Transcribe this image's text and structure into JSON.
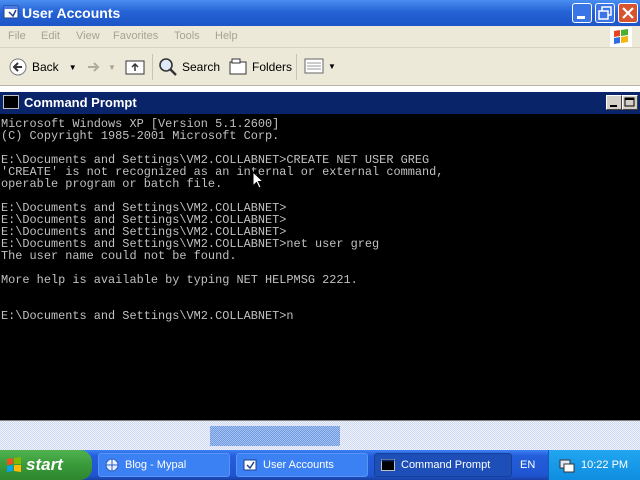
{
  "explorer": {
    "title": "User Accounts",
    "menu": [
      "File",
      "Edit",
      "View",
      "Favorites",
      "Tools",
      "Help"
    ],
    "toolbar": {
      "back": "Back",
      "search": "Search",
      "folders": "Folders"
    },
    "icons": [
      "window-icon",
      "back-arrow-icon",
      "forward-arrow-icon",
      "up-folder-icon",
      "search-icon",
      "folders-icon",
      "views-icon",
      "windows-flag-icon"
    ]
  },
  "cmd": {
    "title": "Command Prompt",
    "lines": [
      "Microsoft Windows XP [Version 5.1.2600]",
      "(C) Copyright 1985-2001 Microsoft Corp.",
      "",
      "E:\\Documents and Settings\\VM2.COLLABNET>CREATE NET USER GREG",
      "'CREATE' is not recognized as an internal or external command,",
      "operable program or batch file.",
      "",
      "E:\\Documents and Settings\\VM2.COLLABNET>",
      "E:\\Documents and Settings\\VM2.COLLABNET>",
      "E:\\Documents and Settings\\VM2.COLLABNET>",
      "E:\\Documents and Settings\\VM2.COLLABNET>net user greg",
      "The user name could not be found.",
      "",
      "More help is available by typing NET HELPMSG 2221.",
      "",
      "",
      "E:\\Documents and Settings\\VM2.COLLABNET>n"
    ]
  },
  "taskbar": {
    "start": "start",
    "tasks": [
      {
        "label": "Blog - Mypal",
        "icon": "browser-icon"
      },
      {
        "label": "User Accounts",
        "icon": "user-accounts-icon"
      },
      {
        "label": "Command Prompt",
        "icon": "cmd-icon"
      }
    ],
    "lang": "EN",
    "clock": "10:22 PM"
  },
  "colors": {
    "xp_title_blue": "#245edb",
    "cmd_title_navy": "#0a246a",
    "console_bg": "#000000",
    "console_text": "#c0c0c0",
    "start_green": "#3a9a3a"
  }
}
